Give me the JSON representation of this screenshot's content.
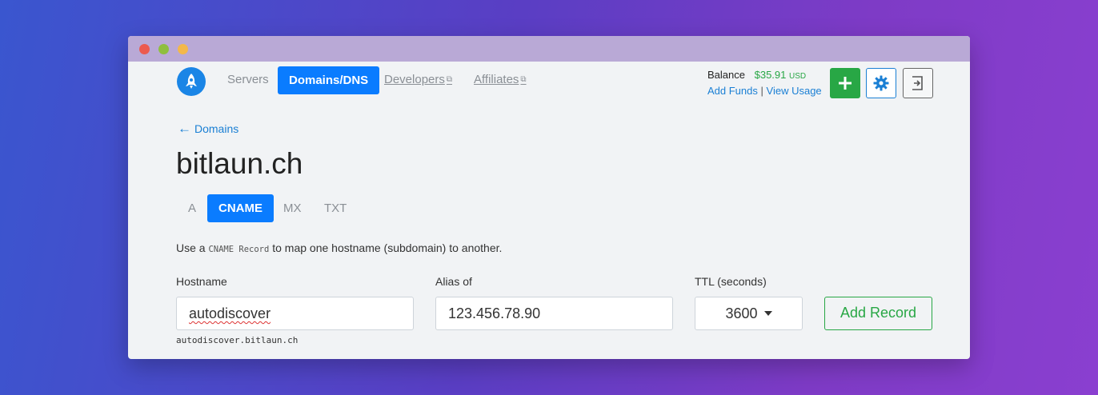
{
  "nav": {
    "servers": "Servers",
    "domains": "Domains/DNS",
    "developers": "Developers",
    "affiliates": "Affiliates",
    "external_icon": "⧉"
  },
  "balance": {
    "label": "Balance",
    "amount": "$35.91",
    "currency": "USD",
    "add_funds": "Add Funds",
    "separator": "|",
    "view_usage": "View Usage"
  },
  "actions": {
    "add_icon": "plus-icon",
    "settings_icon": "gear-icon",
    "logout_icon": "logout-icon"
  },
  "breadcrumb": {
    "arrow": "←",
    "label": "Domains"
  },
  "page": {
    "title": "bitlaun.ch"
  },
  "record_tabs": [
    "A",
    "CNAME",
    "MX",
    "TXT"
  ],
  "description": {
    "before": "Use a ",
    "code": "CNAME Record",
    "after": " to map one hostname (subdomain) to another."
  },
  "form": {
    "hostname_label": "Hostname",
    "hostname_value": "autodiscover",
    "alias_label": "Alias of",
    "alias_value": "123.456.78.90",
    "ttl_label": "TTL (seconds)",
    "ttl_value": "3600",
    "add_button": "Add Record",
    "fqdn_preview": "autodiscover.bitlaun.ch"
  },
  "colors": {
    "primary": "#0a7cff",
    "success": "#28a745",
    "link": "#1a7fd4"
  }
}
